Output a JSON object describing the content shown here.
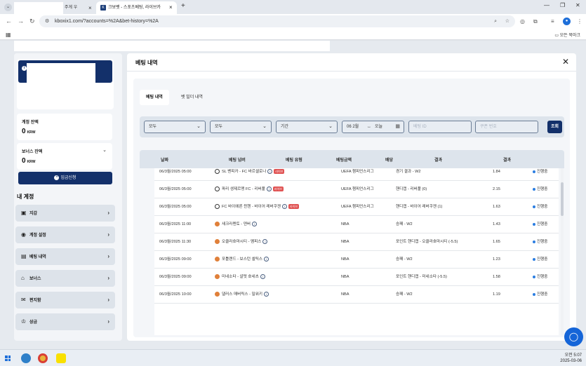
{
  "browser": {
    "tab1_title": "주게 우",
    "tab2_title": "크보벳 - 스포츠베팅, 라이브카",
    "tab2_favicon": "K",
    "url": "kboxix1.com/?accounts=%2A&bet-history=%2A",
    "bookmarks_label": "모든 북마크"
  },
  "sidebar": {
    "balance": {
      "label": "계정 잔액",
      "value": "0",
      "unit": "KRW"
    },
    "bonus": {
      "label": "보너스 잔액",
      "value": "0",
      "unit": "KRW"
    },
    "deposit_label": "입금신청",
    "section_title": "내 계정",
    "menu": [
      {
        "label": "지갑",
        "icon": "wallet-icon"
      },
      {
        "label": "계정 설정",
        "icon": "user-settings-icon"
      },
      {
        "label": "베팅 내역",
        "icon": "bet-history-icon"
      },
      {
        "label": "보너스",
        "icon": "gift-icon"
      },
      {
        "label": "편지함",
        "icon": "mail-icon"
      },
      {
        "label": "상금",
        "icon": "prize-icon"
      }
    ]
  },
  "main": {
    "title": "베팅 내역",
    "tabs": [
      {
        "label": "베팅 내역",
        "active": true
      },
      {
        "label": "벳 빌더 내역",
        "active": false
      }
    ],
    "filters": {
      "select1": "모두",
      "select2": "모두",
      "period": "기간",
      "date_from": "06 2월",
      "date_to": "오늘",
      "input1_placeholder": "베팅 ID",
      "input2_placeholder": "쿠폰 번호",
      "search_label": "조회"
    },
    "table": {
      "headers": [
        "날짜",
        "베팅 넘버",
        "베팅 유형",
        "베팅금액",
        "배당",
        "결과",
        "결과"
      ],
      "live_label": "라이브",
      "rows": [
        {
          "date": "06/3월/2025 05:00",
          "sport": "soccer",
          "event": "SL 벤피카 - FC 바르셀로나",
          "live": true,
          "league": "UEFA 챔피언스리그",
          "market": "경기 결과 - W2",
          "odds": "1.84",
          "status": "진행중"
        },
        {
          "date": "06/3월/2025 05:00",
          "sport": "soccer",
          "event": "파리 생제르맹 FC - 리버풀",
          "live": true,
          "league": "UEFA 챔피언스리그",
          "market": "핸디캡 - 리버풀 (0)",
          "odds": "2.15",
          "status": "진행중"
        },
        {
          "date": "06/3월/2025 05:00",
          "sport": "soccer",
          "event": "FC 바이에른 뮌헨 - 바이어 레버쿠젠",
          "live": true,
          "league": "UEFA 챔피언스리그",
          "market": "핸디캡 - 바이어 레버쿠젠 (1)",
          "odds": "1.63",
          "status": "진행중"
        },
        {
          "date": "06/3월/2025 11:00",
          "sport": "basket",
          "event": "새크라멘토 - 덴버",
          "live": false,
          "league": "NBA",
          "market": "승패 - W2",
          "odds": "1.43",
          "status": "진행중"
        },
        {
          "date": "06/3월/2025 11:30",
          "sport": "basket",
          "event": "오클라호마시티 - 멤피스",
          "live": false,
          "league": "NBA",
          "market": "포인트 핸디캡 - 오클라호마시티 (-5.5)",
          "odds": "1.65",
          "status": "진행중"
        },
        {
          "date": "06/3월/2025 09:00",
          "sport": "basket",
          "event": "포틀랜드 - 보스턴 셀틱스",
          "live": false,
          "league": "NBA",
          "market": "승패 - W2",
          "odds": "1.23",
          "status": "진행중"
        },
        {
          "date": "06/3월/2025 09:00",
          "sport": "basket",
          "event": "미네소타 - 샬럿 호네츠",
          "live": false,
          "league": "NBA",
          "market": "포인트 핸디캡 - 미네소타 (-5.5)",
          "odds": "1.58",
          "status": "진행중"
        },
        {
          "date": "06/3월/2025 10:00",
          "sport": "basket",
          "event": "댈러스 매버릭스 - 밀워키",
          "live": false,
          "league": "NBA",
          "market": "승패 - W2",
          "odds": "1.19",
          "status": "진행중"
        }
      ]
    }
  },
  "taskbar": {
    "time": "오전 5:07",
    "date": "2025-03-06"
  },
  "colors": {
    "primary": "#13306a",
    "live_badge": "#e05252",
    "status_dot": "#2a7de1",
    "chat": "#1565d8"
  }
}
